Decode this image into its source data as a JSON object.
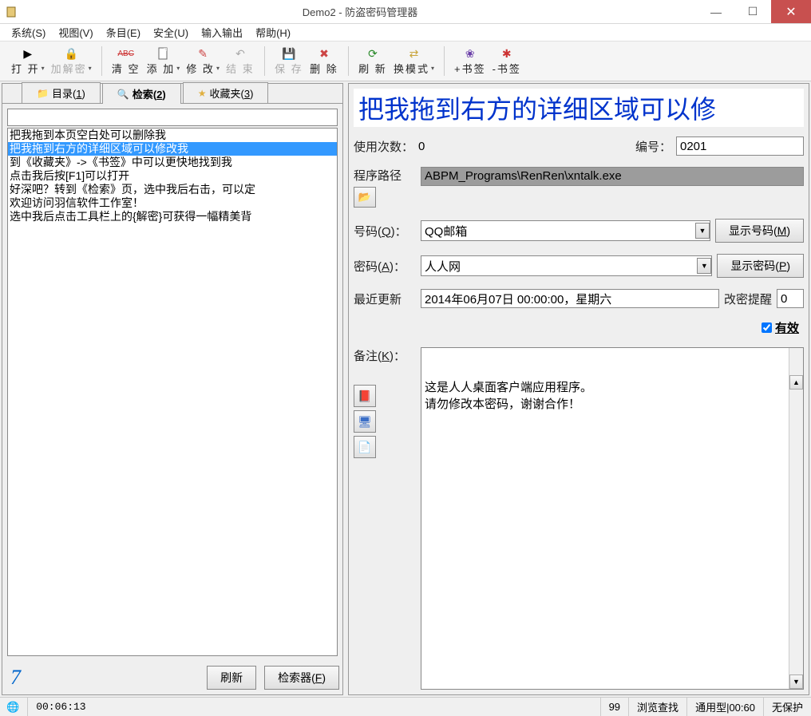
{
  "window": {
    "title": "Demo2 - 防盗密码管理器"
  },
  "menu": {
    "system": "系统(S)",
    "view": "视图(V)",
    "entry": "条目(E)",
    "security": "安全(U)",
    "io": "输入输出",
    "help": "帮助(H)"
  },
  "toolbar": {
    "open": "打 开",
    "decrypt": "加解密",
    "clear": "清 空",
    "add": "添 加",
    "modify": "修 改",
    "end": "结 束",
    "save": "保 存",
    "delete": "删 除",
    "refresh": "刷 新",
    "switch_mode": "换模式",
    "add_bookmark": "+书签",
    "remove_bookmark": "-书签"
  },
  "tabs": {
    "dir_label": "目录(",
    "dir_key": "1",
    "search_label": "检索(",
    "search_key": "2",
    "fav_label": "收藏夹(",
    "fav_key": "3"
  },
  "left": {
    "results": [
      "把我拖到本页空白处可以删除我",
      "把我拖到右方的详细区域可以修改我",
      "到《收藏夹》->《书签》中可以更快地找到我",
      "点击我后按[F1]可以打开",
      "好深吧？转到《检索》页，选中我后右击，可以定",
      "欢迎访问羽信软件工作室！",
      "选中我后点击工具栏上的{解密}可获得一幅精美背"
    ],
    "selected_index": 1,
    "count": "7",
    "refresh_btn": "刷新",
    "indexer_btn_label": "检索器(",
    "indexer_btn_key": "F"
  },
  "right": {
    "banner": "把我拖到右方的详细区域可以修",
    "usage_label": "使用次数：",
    "usage_value": "0",
    "id_label": "编号：",
    "id_value": "0201",
    "path_label": "程序路径",
    "path_value": "ABPM_Programs\\RenRen\\xntalk.exe",
    "number_label": "号码(",
    "number_key": "Q",
    "number_suffix": ")：",
    "number_value": "QQ邮箱",
    "show_number_btn": "显示号码(",
    "show_number_key": "M",
    "password_label": "密码(",
    "password_key": "A",
    "password_suffix": ")：",
    "password_value": "人人网",
    "show_password_btn": "显示密码(",
    "show_password_key": "P",
    "last_update_label": "最近更新",
    "last_update_value": "2014年06月07日 00:00:00，星期六",
    "remind_label": "改密提醒",
    "remind_value": "0",
    "valid_label": "有效",
    "remark_label": "备注(",
    "remark_key": "K",
    "remark_suffix": ")：",
    "remark_text": "这是人人桌面客户端应用程序。\n请勿修改本密码，谢谢合作！"
  },
  "status": {
    "time": "00:06:13",
    "count": "99",
    "browse": "浏览查找",
    "mode": "通用型|00:60",
    "protect": "无保护"
  }
}
